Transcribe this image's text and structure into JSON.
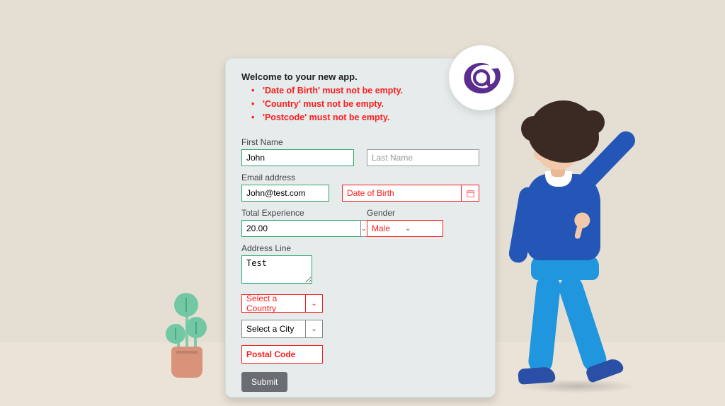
{
  "header": {
    "welcome": "Welcome to your new app."
  },
  "errors": [
    "'Date of Birth'  must not be empty.",
    "'Country' must not be empty.",
    "'Postcode' must not be empty."
  ],
  "labels": {
    "first_name": "First Name",
    "last_name": "Last Name",
    "email": "Email address",
    "dob": "Date of Birth",
    "exp": "Total Experience",
    "gender": "Gender",
    "address": "Address Line"
  },
  "values": {
    "first_name": "John",
    "email": "John@test.com",
    "exp": "20.00",
    "gender": "Male",
    "address": "Test",
    "country": "Select a Country",
    "city": "Select a City",
    "postal": "Postal Code"
  },
  "placeholders": {
    "last_name": "Last Name",
    "dob": "Date of Birth"
  },
  "buttons": {
    "submit": "Submit"
  },
  "colors": {
    "error": "#ff1c1c",
    "valid": "#2fa86b",
    "submit_bg": "#6a6e72",
    "logo": "#5b2d8f"
  }
}
